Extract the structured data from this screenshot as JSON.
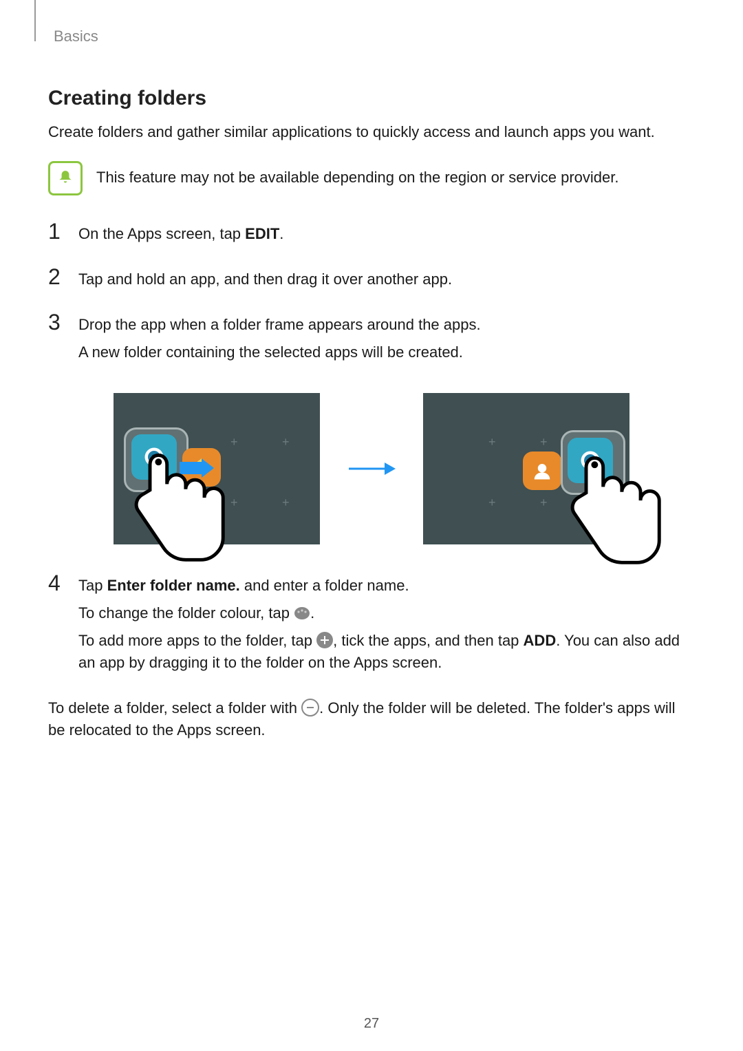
{
  "breadcrumb": "Basics",
  "section_title": "Creating folders",
  "intro": "Create folders and gather similar applications to quickly access and launch apps you want.",
  "note": "This feature may not be available depending on the region or service provider.",
  "steps": {
    "s1_a": "On the Apps screen, tap ",
    "s1_b": "EDIT",
    "s1_c": ".",
    "s2": "Tap and hold an app, and then drag it over another app.",
    "s3": "Drop the app when a folder frame appears around the apps.",
    "s3b": "A new folder containing the selected apps will be created.",
    "s4_a": "Tap ",
    "s4_b": "Enter folder name.",
    "s4_c": " and enter a folder name.",
    "s4_colour_pre": "To change the folder colour, tap ",
    "s4_colour_post": ".",
    "s4_add_pre": "To add more apps to the folder, tap ",
    "s4_add_mid": ", tick the apps, and then tap ",
    "s4_add_bold": "ADD",
    "s4_add_post": ". You can also add an app by dragging it to the folder on the Apps screen."
  },
  "trailing_pre": "To delete a folder, select a folder with ",
  "trailing_post": ". Only the folder will be deleted. The folder's apps will be relocated to the Apps screen.",
  "page_number": "27"
}
